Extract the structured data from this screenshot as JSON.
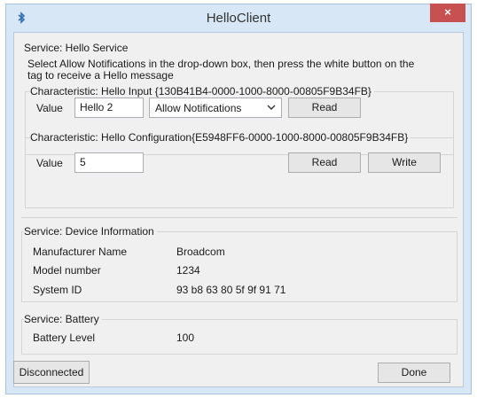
{
  "window": {
    "title": "HelloClient",
    "close": "×"
  },
  "hello_service": {
    "header": "Service: Hello Service",
    "instruction_line1": "Select Allow Notifications in the drop-down box, then press the white button on the",
    "instruction_line2": "tag to receive a Hello message",
    "input_char": {
      "header": "Characteristic: Hello Input {130B41B4-0000-1000-8000-00805F9B34FB}",
      "value_label": "Value",
      "value": "Hello 2",
      "dropdown_selected": "Allow Notifications",
      "read_label": "Read"
    },
    "config_char": {
      "header": "Characteristic: Hello Configuration{E5948FF6-0000-1000-8000-00805F9B34FB}",
      "value_label": "Value",
      "value": "5",
      "read_label": "Read",
      "write_label": "Write"
    }
  },
  "device_info": {
    "header": "Service: Device Information",
    "rows": [
      {
        "label": "Manufacturer Name",
        "value": "Broadcom"
      },
      {
        "label": "Model number",
        "value": "1234"
      },
      {
        "label": "System ID",
        "value": "93 b8 63 80 5f 9f 91 71"
      }
    ]
  },
  "battery": {
    "header": "Service: Battery",
    "label": "Battery Level",
    "value": "100"
  },
  "footer": {
    "status_button": "Disconnected",
    "done_button": "Done"
  }
}
